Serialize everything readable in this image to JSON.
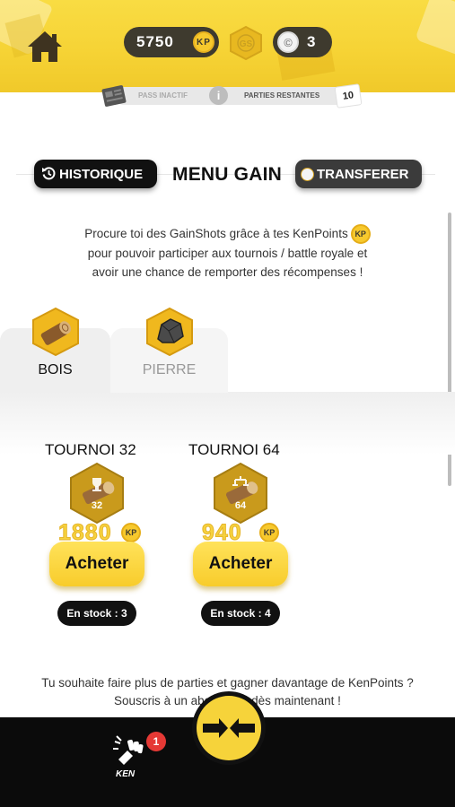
{
  "header": {
    "kp_balance": "5750",
    "kp_badge": "KP",
    "gs_badge": "GS",
    "ticket_count": "3",
    "ticket_symbol": "©",
    "pass_status": "PASS INACTIF",
    "info_symbol": "i",
    "parties_label": "PARTIES RESTANTES",
    "parties_count": "10"
  },
  "menu": {
    "history_label": "HISTORIQUE",
    "title": "MENU GAIN",
    "transfer_label": "TRANSFERER"
  },
  "description": {
    "line1": "Procure toi des GainShots grâce à tes KenPoints",
    "kp_badge": "KP",
    "line2": "pour pouvoir participer aux tournois / battle royale et",
    "line3": "avoir une chance de remporter des récompenses !"
  },
  "tabs": [
    {
      "label": "BOIS",
      "icon": "wood-log-icon",
      "active": true
    },
    {
      "label": "PIERRE",
      "icon": "stone-icon",
      "active": false
    }
  ],
  "cards": [
    {
      "title": "TOURNOI  32",
      "hex_number": "32",
      "price": "1880",
      "kp_badge": "KP",
      "buy_label": "Acheter",
      "stock_label": "En stock : 3"
    },
    {
      "title": "TOURNOI  64",
      "hex_number": "64",
      "price": "940",
      "kp_badge": "KP",
      "buy_label": "Acheter",
      "stock_label": "En stock : 4"
    }
  ],
  "promo": {
    "line1": "Tu souhaite faire plus de parties et gagner davantage de KenPoints ?",
    "line2": "Souscris à un abo          t dès maintenant !"
  },
  "bottom_nav": {
    "ken_label": "KEN",
    "notification_count": "1"
  },
  "colors": {
    "accent_yellow": "#f6d335",
    "dark": "#111111",
    "pill_dark": "#3e3a2e",
    "hex_gold": "#d9a520",
    "notification_red": "#e53935"
  }
}
